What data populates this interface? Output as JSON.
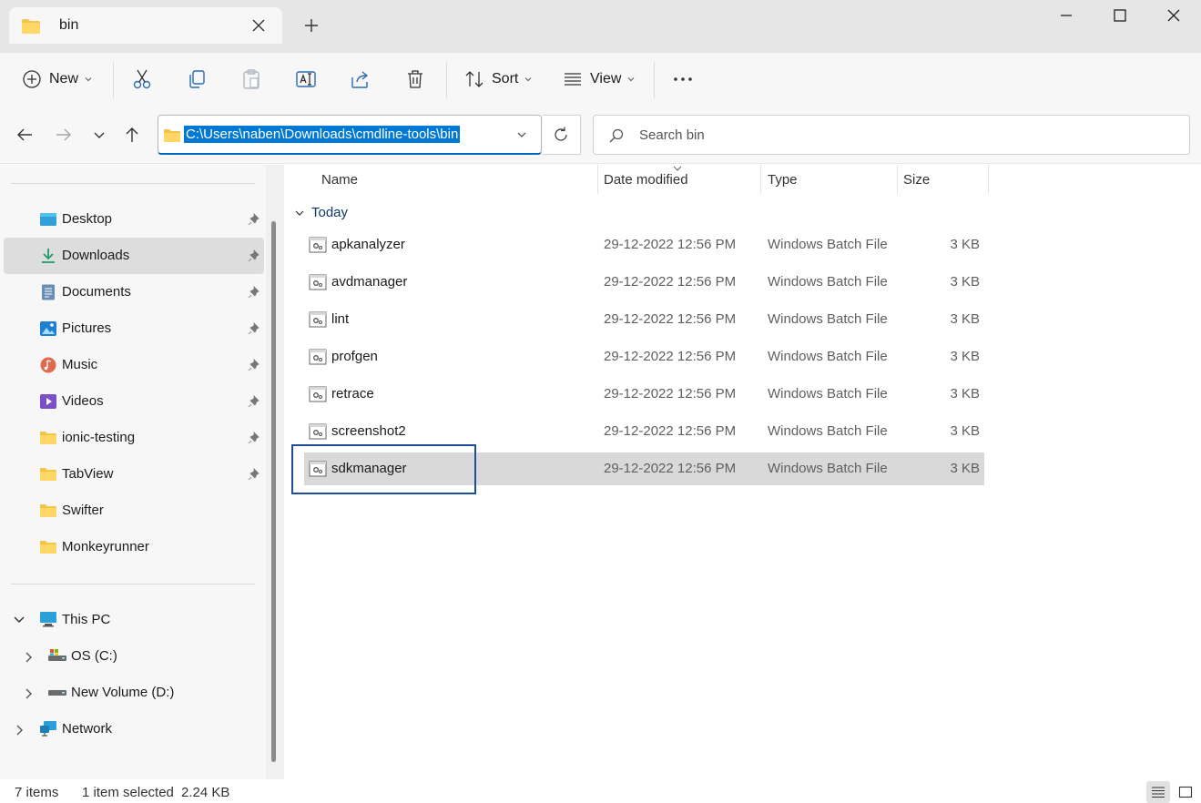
{
  "window": {
    "tab_title": "bin",
    "tab_close": "close",
    "new_tab": "add",
    "controls": [
      "minimize",
      "maximize",
      "close"
    ]
  },
  "commandbar": {
    "new_label": "New",
    "sort_label": "Sort",
    "view_label": "View",
    "icons": [
      "cut-icon",
      "copy-icon",
      "paste-icon",
      "rename-icon",
      "share-icon",
      "delete-icon",
      "more-icon"
    ]
  },
  "address": {
    "path": "C:\\Users\\naben\\Downloads\\cmdline-tools\\bin",
    "search_placeholder": "Search bin"
  },
  "sidebar": {
    "quick_access": [
      {
        "label": "Desktop",
        "icon": "desktop-icon",
        "pinned": true
      },
      {
        "label": "Downloads",
        "icon": "downloads-icon",
        "pinned": true,
        "active": true
      },
      {
        "label": "Documents",
        "icon": "documents-icon",
        "pinned": true
      },
      {
        "label": "Pictures",
        "icon": "pictures-icon",
        "pinned": true
      },
      {
        "label": "Music",
        "icon": "music-icon",
        "pinned": true
      },
      {
        "label": "Videos",
        "icon": "videos-icon",
        "pinned": true
      },
      {
        "label": "ionic-testing",
        "icon": "folder-icon",
        "pinned": true
      },
      {
        "label": "TabView",
        "icon": "folder-icon",
        "pinned": true
      },
      {
        "label": "Swifter",
        "icon": "folder-icon",
        "pinned": false
      },
      {
        "label": "Monkeyrunner",
        "icon": "folder-icon",
        "pinned": false
      }
    ],
    "tree": [
      {
        "label": "This PC",
        "icon": "pc-icon",
        "expanded": true
      },
      {
        "label": "OS (C:)",
        "icon": "drive-icon",
        "expanded": false
      },
      {
        "label": "New Volume (D:)",
        "icon": "drive-icon",
        "expanded": false
      },
      {
        "label": "Network",
        "icon": "network-icon",
        "expanded": false
      }
    ]
  },
  "filelist": {
    "columns": [
      "Name",
      "Date modified",
      "Type",
      "Size"
    ],
    "group": "Today",
    "rows": [
      {
        "name": "apkanalyzer",
        "date": "29-12-2022 12:56 PM",
        "type": "Windows Batch File",
        "size": "3 KB"
      },
      {
        "name": "avdmanager",
        "date": "29-12-2022 12:56 PM",
        "type": "Windows Batch File",
        "size": "3 KB"
      },
      {
        "name": "lint",
        "date": "29-12-2022 12:56 PM",
        "type": "Windows Batch File",
        "size": "3 KB"
      },
      {
        "name": "profgen",
        "date": "29-12-2022 12:56 PM",
        "type": "Windows Batch File",
        "size": "3 KB"
      },
      {
        "name": "retrace",
        "date": "29-12-2022 12:56 PM",
        "type": "Windows Batch File",
        "size": "3 KB"
      },
      {
        "name": "screenshot2",
        "date": "29-12-2022 12:56 PM",
        "type": "Windows Batch File",
        "size": "3 KB"
      },
      {
        "name": "sdkmanager",
        "date": "29-12-2022 12:56 PM",
        "type": "Windows Batch File",
        "size": "3 KB",
        "selected": true
      }
    ]
  },
  "status": {
    "items": "7 items",
    "selected": "1 item selected",
    "size": "2.24 KB"
  },
  "colors": {
    "accent": "#0078d4",
    "folder": "#f4c34a",
    "selection": "#d9d9d9"
  }
}
